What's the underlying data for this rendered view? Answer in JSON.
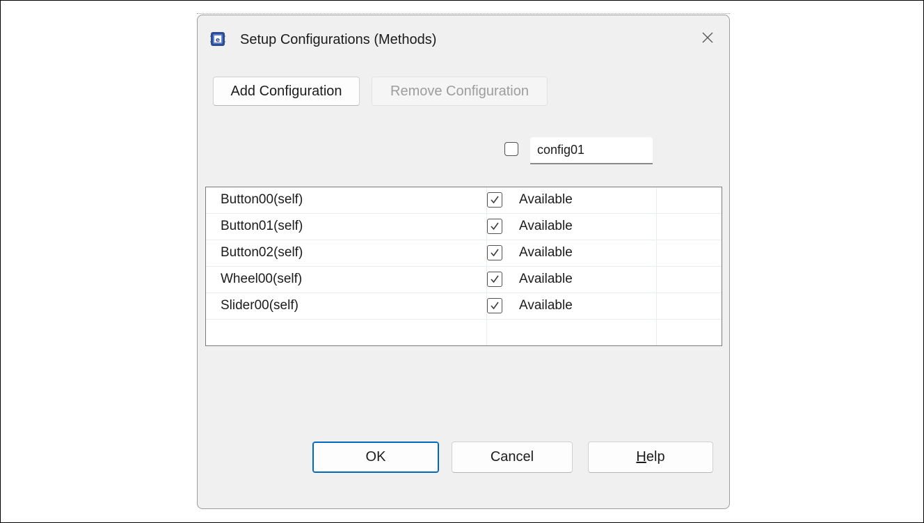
{
  "dialog": {
    "title": "Setup Configurations (Methods)",
    "icon": "chip-app-icon",
    "close_icon": "close-icon"
  },
  "toolbar": {
    "add_label": "Add Configuration",
    "remove_label": "Remove Configuration"
  },
  "config_header": {
    "checked": false,
    "name_value": "config01"
  },
  "table": {
    "rows": [
      {
        "name": "Button00(self)",
        "checked": true,
        "status": "Available"
      },
      {
        "name": "Button01(self)",
        "checked": true,
        "status": "Available"
      },
      {
        "name": "Button02(self)",
        "checked": true,
        "status": "Available"
      },
      {
        "name": "Wheel00(self)",
        "checked": true,
        "status": "Available"
      },
      {
        "name": "Slider00(self)",
        "checked": true,
        "status": "Available"
      }
    ]
  },
  "footer": {
    "ok_label": "OK",
    "cancel_label": "Cancel",
    "help_mnemonic": "H",
    "help_rest": "elp"
  },
  "colors": {
    "accent": "#0067c0",
    "dialog_bg": "#f0f0f0",
    "disabled_text": "#9d9d9d"
  }
}
